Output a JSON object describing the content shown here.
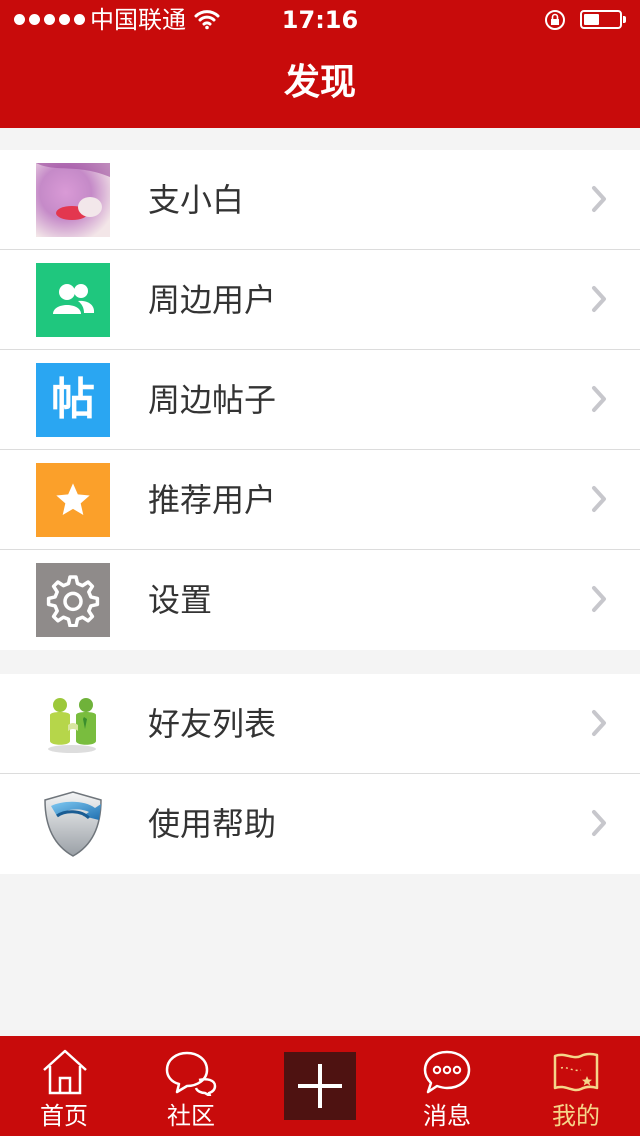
{
  "status_bar": {
    "carrier": "中国联通",
    "time": "17:16"
  },
  "header": {
    "title": "发现"
  },
  "colors": {
    "brand_red": "#c80b0b",
    "nearby_users": "#1fc77e",
    "nearby_posts": "#2aa6f2",
    "recommend": "#fba02a",
    "settings": "#8f8b8a",
    "tab_active": "#f5d58a"
  },
  "list1": [
    {
      "label": "支小白",
      "icon": "avatar-photo"
    },
    {
      "label": "周边用户",
      "icon": "users-icon"
    },
    {
      "label": "周边帖子",
      "icon": "post-icon",
      "icon_text": "帖"
    },
    {
      "label": "推荐用户",
      "icon": "star-icon"
    },
    {
      "label": "设置",
      "icon": "gear-icon"
    }
  ],
  "list2": [
    {
      "label": "好友列表",
      "icon": "friends-icon"
    },
    {
      "label": "使用帮助",
      "icon": "help-shield-icon"
    }
  ],
  "tabbar": {
    "items": [
      {
        "label": "首页",
        "icon": "home-icon",
        "active": false
      },
      {
        "label": "社区",
        "icon": "chat-bubbles-icon",
        "active": false
      },
      {
        "label": "",
        "icon": "plus-icon",
        "active": false
      },
      {
        "label": "消息",
        "icon": "message-icon",
        "active": false
      },
      {
        "label": "我的",
        "icon": "flag-map-icon",
        "active": true
      }
    ]
  }
}
